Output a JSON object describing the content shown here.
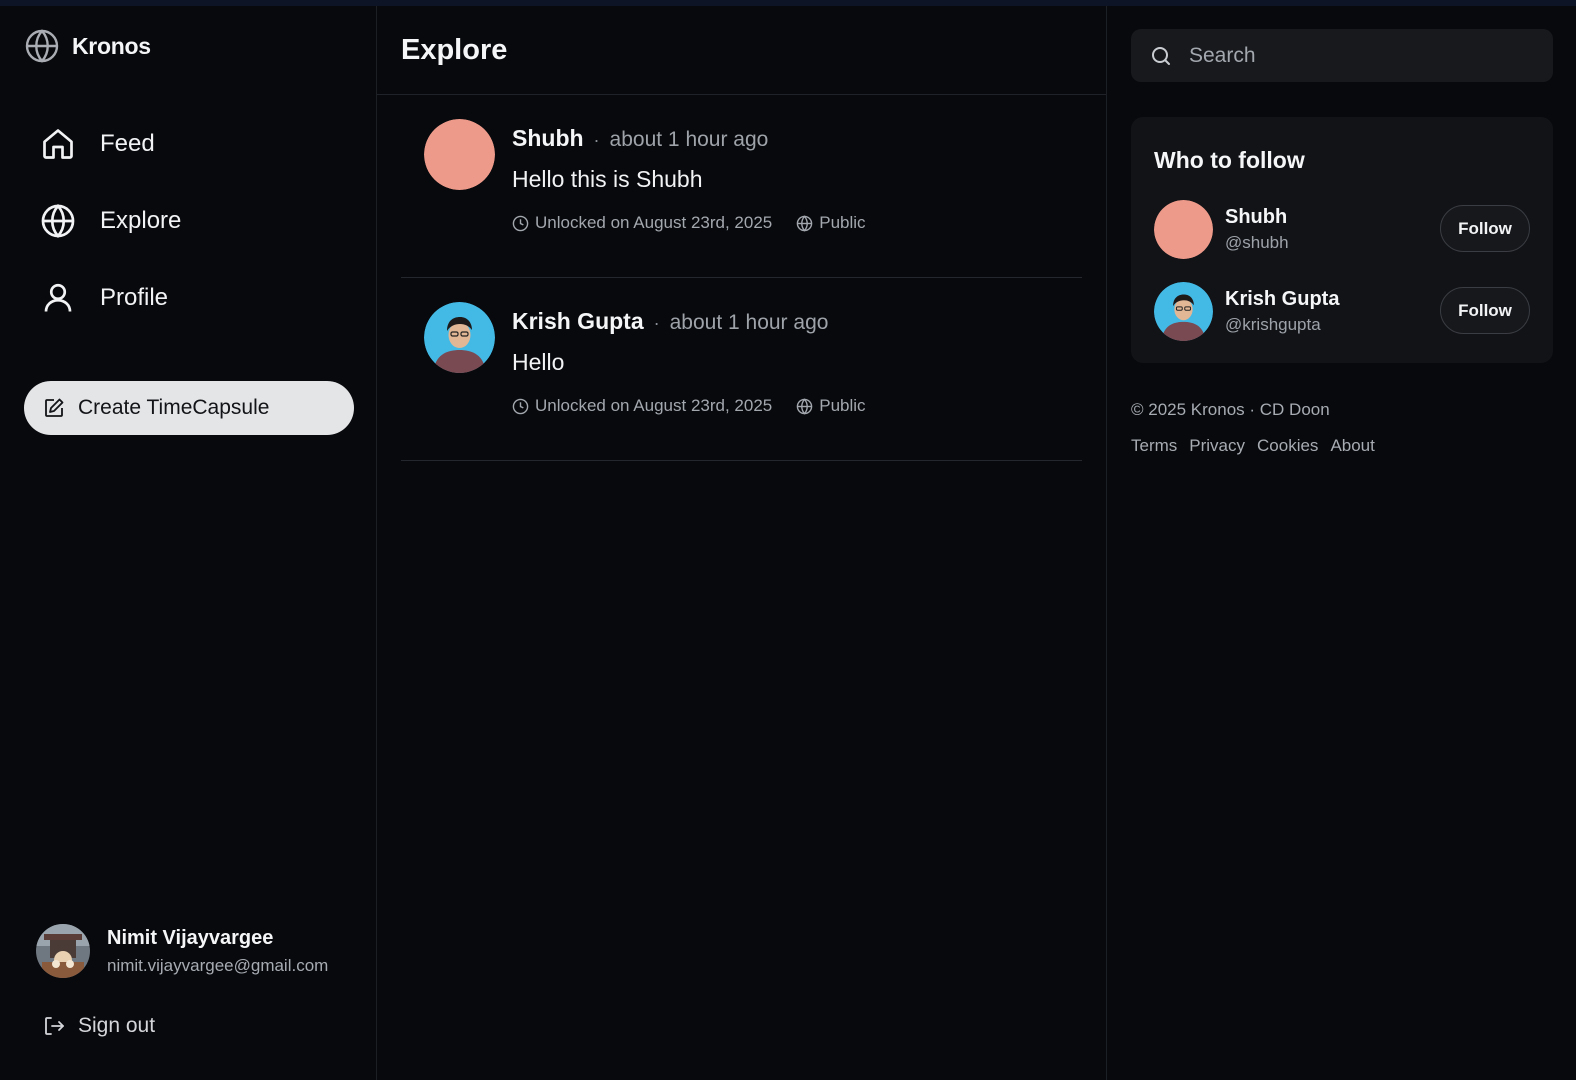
{
  "app": {
    "name": "Kronos"
  },
  "sidebar": {
    "nav": [
      {
        "label": "Feed",
        "icon": "home-icon"
      },
      {
        "label": "Explore",
        "icon": "globe-icon"
      },
      {
        "label": "Profile",
        "icon": "user-icon"
      }
    ],
    "create_label": "Create TimeCapsule",
    "user": {
      "name": "Nimit Vijayvargee",
      "email": "nimit.vijayvargee@gmail.com"
    },
    "signout_label": "Sign out"
  },
  "main": {
    "title": "Explore",
    "posts": [
      {
        "author": "Shubh",
        "separator": "·",
        "time": "about 1 hour ago",
        "body": "Hello this is Shubh",
        "unlocked": "Unlocked on August 23rd, 2025",
        "visibility": "Public",
        "avatar": "solid-salmon"
      },
      {
        "author": "Krish Gupta",
        "separator": "·",
        "time": "about 1 hour ago",
        "body": "Hello",
        "unlocked": "Unlocked on August 23rd, 2025",
        "visibility": "Public",
        "avatar": "photo"
      }
    ]
  },
  "right": {
    "search_placeholder": "Search",
    "who_to_follow": {
      "title": "Who to follow",
      "users": [
        {
          "name": "Shubh",
          "handle": "@shubh",
          "button": "Follow"
        },
        {
          "name": "Krish Gupta",
          "handle": "@krishgupta",
          "button": "Follow"
        }
      ]
    },
    "footer": {
      "copyright": "© 2025 Kronos · CD Doon",
      "links": [
        "Terms",
        "Privacy",
        "Cookies",
        "About"
      ]
    }
  },
  "colors": {
    "background": "#07090c",
    "avatar_salmon": "#ee9a8a",
    "avatar_photo_bg": "#43b9e6",
    "create_button_bg": "#e4e5e7"
  }
}
